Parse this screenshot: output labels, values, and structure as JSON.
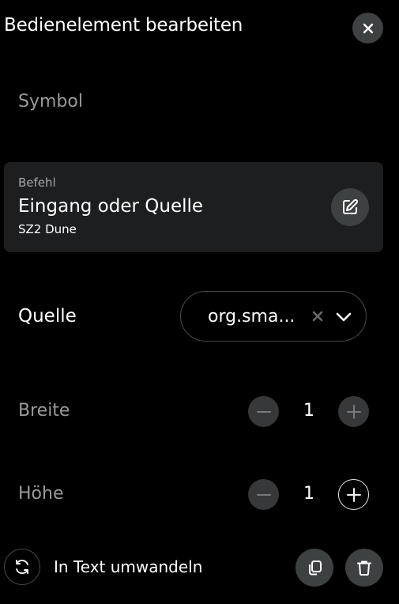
{
  "header": {
    "title": "Bedienelement bearbeiten",
    "close_icon": "close-icon"
  },
  "symbol": {
    "label": "Symbol"
  },
  "command": {
    "caption": "Befehl",
    "title": "Eingang oder Quelle",
    "subtitle": "SZ2 Dune",
    "edit_icon": "edit-icon"
  },
  "source": {
    "label": "Quelle",
    "value": "org.sma...",
    "clear_icon": "clear-icon",
    "chevron_icon": "chevron-down-icon"
  },
  "width": {
    "label": "Breite",
    "value": "1",
    "decrement_enabled": false,
    "increment_enabled": false
  },
  "height": {
    "label": "Höhe",
    "value": "1",
    "decrement_enabled": false,
    "increment_enabled": true
  },
  "footer": {
    "convert_label": "In Text umwandeln",
    "convert_icon": "refresh-icon",
    "copy_icon": "copy-icon",
    "delete_icon": "trash-icon"
  },
  "colors": {
    "background": "#000000",
    "card": "#1d1e1f",
    "button": "#3e4142",
    "muted_text": "#9a9a9a"
  }
}
